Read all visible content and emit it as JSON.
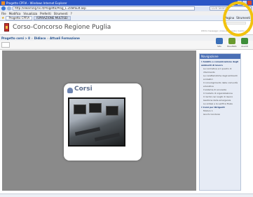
{
  "window": {
    "title": "Progetto CPFIA - Windows Internet Explorer"
  },
  "browser": {
    "address": "http://elearning.tis.it/Progetto/Prog_1.2/default.asp",
    "search_placeholder": "Live Search",
    "menu": [
      "File",
      "Modifica",
      "Visualizza",
      "Preferiti",
      "Strumenti",
      "?"
    ],
    "tabs": [
      "Progetto CPFIA",
      "ISPIRAZIONE MULTISEI"
    ],
    "tools": [
      "Pagina",
      "Strumenti"
    ]
  },
  "app": {
    "name": "Corso-Concorso Regione Puglia",
    "header_links": "Ultimi messaggi | Area personale | Guida | Esci"
  },
  "breadcrumb": [
    "Progetto corsi > 8",
    "Didiaco",
    "Attuali Formazione"
  ],
  "actions": [
    {
      "label": "Sito",
      "color": "#3a6fb8"
    },
    {
      "label": "Risultato",
      "color": "#6a9a2e"
    },
    {
      "label": "Avanti",
      "color": "#3e8e3a"
    }
  ],
  "course_card": {
    "title": "Corsi"
  },
  "sidebar": {
    "title": "Navigazione",
    "items": [
      {
        "text": "▾ Ambito e comunicazione degli ambienti di lavoro",
        "kind": "grp"
      },
      {
        "text": "La normativa e il quadro di riferimento",
        "kind": "sub"
      },
      {
        "text": "Le caratteristiche degli ambienti scolastici",
        "kind": "sub"
      },
      {
        "text": "Il coinvolgimento della comunità educativa",
        "kind": "sub"
      },
      {
        "text": "Il sistema di sicurezza",
        "kind": "sub"
      },
      {
        "text": "Il modello di organizzazione",
        "kind": "sub"
      },
      {
        "text": "Il rischio nei luoghi di lavoro",
        "kind": "sub"
      },
      {
        "text": "Gestione delle emergenze",
        "kind": "sub"
      },
      {
        "text": "La sintesi e la verifica finale",
        "kind": "sub"
      },
      {
        "text": "▾ Corsi per Dirigenti",
        "kind": "grp"
      },
      {
        "text": "Modulo 1",
        "kind": "sub"
      },
      {
        "text": "Giochi Condivisi",
        "kind": "sub"
      }
    ]
  },
  "colors": {
    "highlight_ring": "#f2c20f",
    "workspace_bg": "#8a8a8a",
    "accent": "#2a56c6"
  }
}
